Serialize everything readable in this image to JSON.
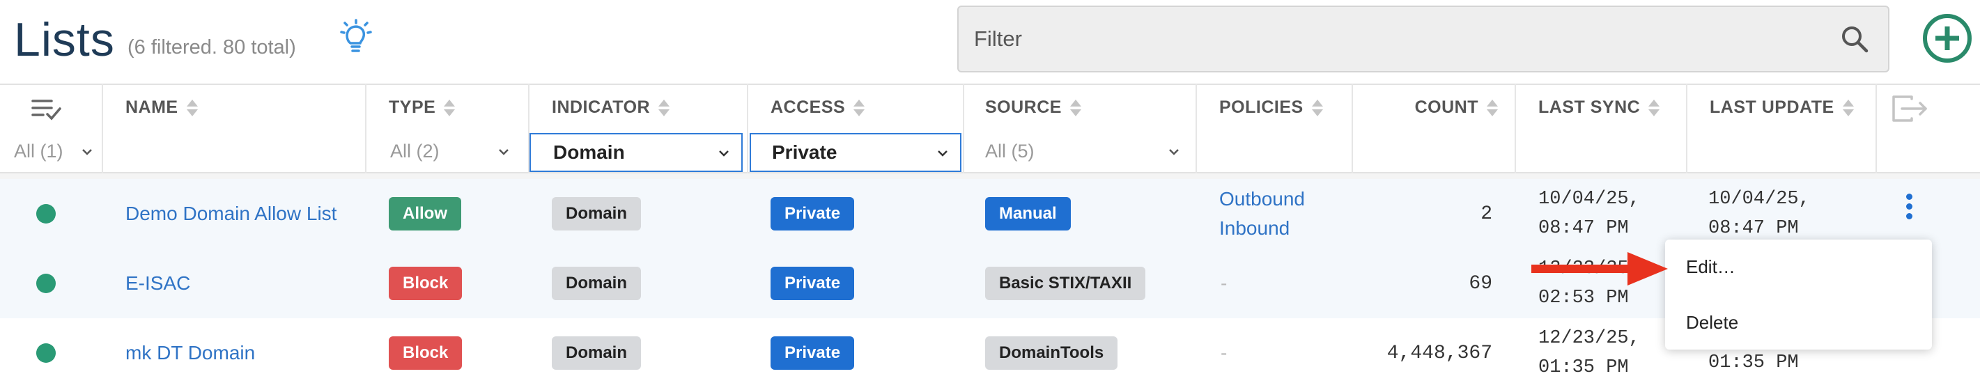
{
  "header": {
    "title": "Lists",
    "subtitle": "(6 filtered. 80 total)",
    "filter_placeholder": "Filter"
  },
  "columns": {
    "name": "NAME",
    "type": "TYPE",
    "indicator": "INDICATOR",
    "access": "ACCESS",
    "source": "SOURCE",
    "policies": "POLICIES",
    "count": "COUNT",
    "last_sync": "LAST SYNC",
    "last_update": "LAST UPDATE"
  },
  "filters": {
    "status": "All (1)",
    "type": "All (2)",
    "indicator": "Domain",
    "access": "Private",
    "source": "All (5)"
  },
  "rows": [
    {
      "name": "Demo Domain Allow List",
      "type": "Allow",
      "indicator": "Domain",
      "access": "Private",
      "source": "Manual",
      "policy_1": "Outbound",
      "policy_2": "Inbound",
      "count": "2",
      "last_sync_date": "10/04/25,",
      "last_sync_time": "08:47 PM",
      "last_update_date": "10/04/25,",
      "last_update_time": "08:47 PM"
    },
    {
      "name": "E-ISAC",
      "type": "Block",
      "indicator": "Domain",
      "access": "Private",
      "source": "Basic STIX/TAXII",
      "policies": "-",
      "count": "69",
      "last_sync_date": "12/23/25,",
      "last_sync_time": "02:53 PM"
    },
    {
      "name": "mk DT Domain",
      "type": "Block",
      "indicator": "Domain",
      "access": "Private",
      "source": "DomainTools",
      "policies": "-",
      "count": "4,448,367",
      "last_sync_date": "12/23/25,",
      "last_sync_time": "01:35 PM",
      "last_update_time": "01:35 PM"
    }
  ],
  "menu": {
    "edit": "Edit…",
    "delete": "Delete"
  },
  "colors": {
    "accent": "#1f6fd1",
    "allow": "#3d9a73",
    "block": "#e05151",
    "status_dot": "#2a9a75",
    "arrow": "#e8321e"
  },
  "icons": {
    "idea": "lightbulb-icon",
    "search": "search-icon",
    "add": "plus-circle-icon",
    "columns": "list-check-icon",
    "export": "export-icon",
    "row_menu": "kebab-icon"
  }
}
